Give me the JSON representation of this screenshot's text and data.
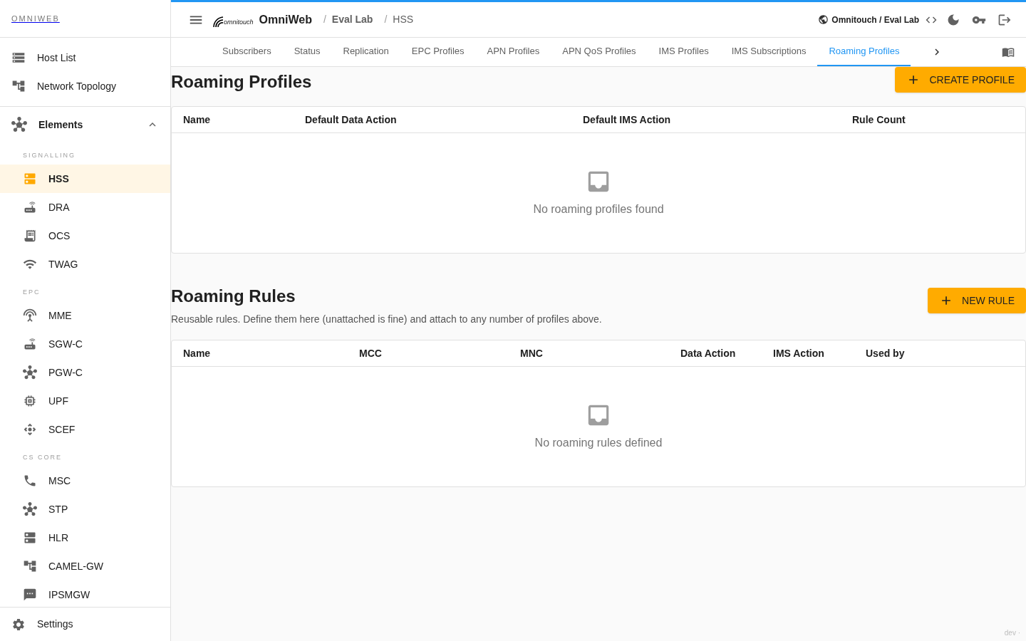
{
  "sidebar": {
    "brand": "OMNIWEB",
    "top_items": [
      {
        "label": "Host List"
      },
      {
        "label": "Network Topology"
      }
    ],
    "group": {
      "label": "Elements",
      "expanded": true,
      "sections": [
        {
          "title": "SIGNALLING",
          "items": [
            {
              "label": "HSS",
              "selected": true
            },
            {
              "label": "DRA",
              "selected": false
            },
            {
              "label": "OCS",
              "selected": false
            },
            {
              "label": "TWAG",
              "selected": false
            }
          ]
        },
        {
          "title": "EPC",
          "items": [
            {
              "label": "MME",
              "selected": false
            },
            {
              "label": "SGW-C",
              "selected": false
            },
            {
              "label": "PGW-C",
              "selected": false
            },
            {
              "label": "UPF",
              "selected": false
            },
            {
              "label": "SCEF",
              "selected": false
            }
          ]
        },
        {
          "title": "CS CORE",
          "items": [
            {
              "label": "MSC",
              "selected": false
            },
            {
              "label": "STP",
              "selected": false
            },
            {
              "label": "HLR",
              "selected": false
            },
            {
              "label": "CAMEL-GW",
              "selected": false
            },
            {
              "label": "IPSMGW",
              "selected": false
            }
          ]
        }
      ]
    },
    "settings": "Settings"
  },
  "header": {
    "logo_text": "omnitouch",
    "app_name": "OmniWeb",
    "breadcrumb_separator": "/",
    "breadcrumbs": [
      "Eval Lab",
      "HSS"
    ],
    "tenant": "Omnitouch / Eval Lab"
  },
  "tabs": [
    {
      "label": "Subscribers",
      "selected": false
    },
    {
      "label": "Status",
      "selected": false
    },
    {
      "label": "Replication",
      "selected": false
    },
    {
      "label": "EPC Profiles",
      "selected": false
    },
    {
      "label": "APN Profiles",
      "selected": false
    },
    {
      "label": "APN QoS Profiles",
      "selected": false
    },
    {
      "label": "IMS Profiles",
      "selected": false
    },
    {
      "label": "IMS Subscriptions",
      "selected": false
    },
    {
      "label": "Roaming Profiles",
      "selected": true
    }
  ],
  "profiles": {
    "title": "Roaming Profiles",
    "button": "CREATE PROFILE",
    "columns": [
      "Name",
      "Default Data Action",
      "Default IMS Action",
      "Rule Count"
    ],
    "empty": "No roaming profiles found"
  },
  "rules": {
    "title": "Roaming Rules",
    "subtitle": "Reusable rules. Define them here (unattached is fine) and attach to any number of profiles above.",
    "button": "NEW RULE",
    "columns": [
      "Name",
      "MCC",
      "MNC",
      "Data Action",
      "IMS Action",
      "Used by"
    ],
    "empty": "No roaming rules defined"
  },
  "footer": "dev ·"
}
